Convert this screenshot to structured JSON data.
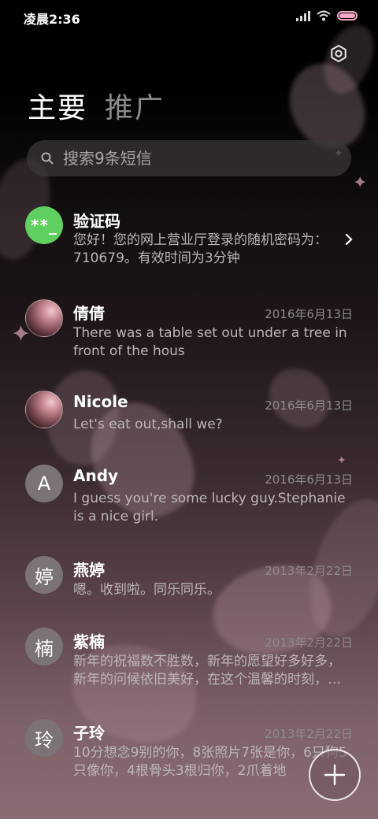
{
  "status_bar": {
    "time": "凌晨2:36"
  },
  "tabs": [
    {
      "label": "主要"
    },
    {
      "label": "推广"
    }
  ],
  "search": {
    "placeholder": "搜索9条短信"
  },
  "conversations": [
    {
      "name": "验证码",
      "avatar_text": "**_",
      "avatar_style": "green",
      "date": "",
      "preview": "您好！您的网上营业厅登录的随机密码为：710679。有效时间为3分钟"
    },
    {
      "name": "倩倩",
      "avatar_text": "",
      "avatar_style": "photo",
      "date": "2016年6月13日",
      "preview": "There was a table set out under a tree in front of the hous"
    },
    {
      "name": "Nicole",
      "avatar_text": "",
      "avatar_style": "photo",
      "date": "2016年6月13日",
      "preview": "Let's eat out,shall we?"
    },
    {
      "name": "Andy",
      "avatar_text": "A",
      "avatar_style": "grey",
      "date": "2016年6月13日",
      "preview": "I guess you're some lucky guy.Stephanie is a nice girl."
    },
    {
      "name": "燕婷",
      "avatar_text": "婷",
      "avatar_style": "grey",
      "date": "2013年2月22日",
      "preview": "嗯。收到啦。同乐同乐。"
    },
    {
      "name": "紫楠",
      "avatar_text": "楠",
      "avatar_style": "grey",
      "date": "2013年2月22日",
      "preview": "新年的祝福数不胜数，新年的愿望好多好多，新年的问候依旧美好，在这个温馨的时刻，…"
    },
    {
      "name": "子玲",
      "avatar_text": "玲",
      "avatar_style": "grey",
      "date": "2013年2月22日",
      "preview": "10分想念9别的你，8张照片7张是你，6只狗5只像你，4根骨头3根归你，2爪着地"
    }
  ],
  "icons": {
    "settings": "settings-icon",
    "search": "search-icon",
    "compose": "plus-icon",
    "chevron": "chevron-right-icon"
  },
  "colors": {
    "accent_green": "#5fcf5f",
    "battery": "#f4a9c7"
  }
}
